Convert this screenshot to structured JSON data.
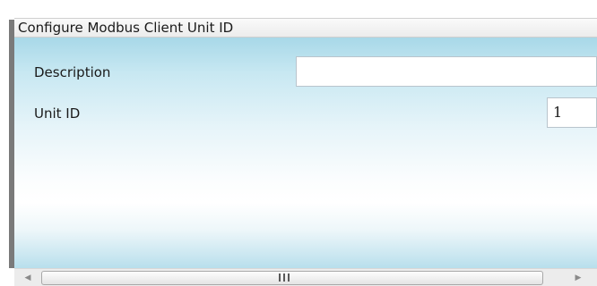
{
  "dialog": {
    "title": "Configure Modbus Client Unit ID"
  },
  "form": {
    "description": {
      "label": "Description",
      "value": ""
    },
    "unit_id": {
      "label": "Unit ID",
      "value": "1"
    }
  },
  "icons": {
    "scroll_left": "chevron-left-icon",
    "scroll_right": "chevron-right-icon",
    "thumb_grip": "grip-icon"
  },
  "colors": {
    "content_gradient_top": "#a8d8e8",
    "content_gradient_bottom": "#b8dfec",
    "left_border": "#7a7a7a"
  }
}
